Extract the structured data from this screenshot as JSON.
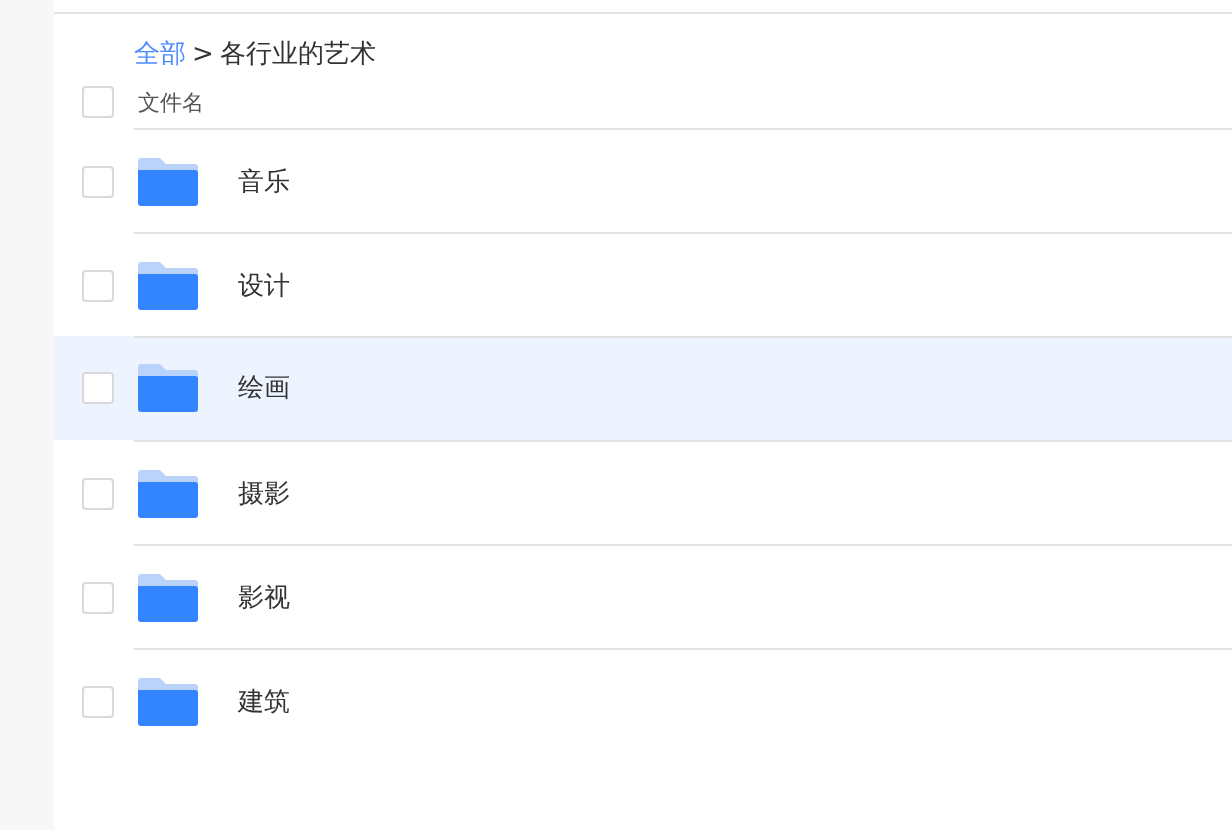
{
  "breadcrumb": [
    {
      "label": "全部",
      "kind": "link"
    },
    {
      "label": ">",
      "kind": "separator"
    },
    {
      "label": "各行业的艺术",
      "kind": "current"
    }
  ],
  "header": {
    "checked": false,
    "column": "文件名"
  },
  "rows": [
    {
      "name": "音乐",
      "checked": false,
      "selected": false
    },
    {
      "name": "设计",
      "checked": false,
      "selected": false
    },
    {
      "name": "绘画",
      "checked": false,
      "selected": true
    },
    {
      "name": "摄影",
      "checked": false,
      "selected": false
    },
    {
      "name": "影视",
      "checked": false,
      "selected": false
    },
    {
      "name": "建筑",
      "checked": false,
      "selected": false
    }
  ]
}
